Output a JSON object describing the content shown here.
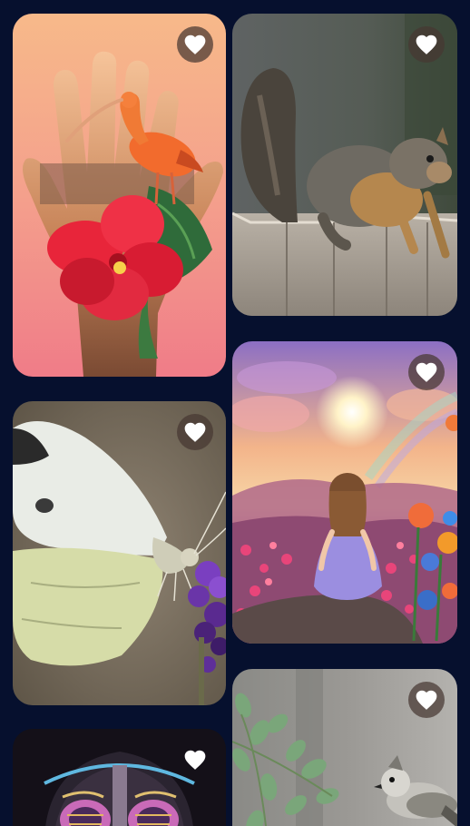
{
  "feed": {
    "background": "#06102e",
    "cards": [
      {
        "image": "hand-with-ibis-and-hibiscus",
        "favorite_icon": "heart-icon"
      },
      {
        "image": "squirrel-on-fence",
        "favorite_icon": "heart-icon"
      },
      {
        "image": "white-butterfly-on-purple-flower",
        "favorite_icon": "heart-icon"
      },
      {
        "image": "girl-in-flower-field-at-sunset",
        "favorite_icon": "heart-icon"
      },
      {
        "image": "robotic-face-portrait",
        "favorite_icon": "heart-icon"
      },
      {
        "image": "bird-on-branch-with-leaves",
        "favorite_icon": "heart-icon"
      }
    ]
  },
  "colors": {
    "heart": "#ffffff",
    "favorite_button_bg": "#463732"
  }
}
